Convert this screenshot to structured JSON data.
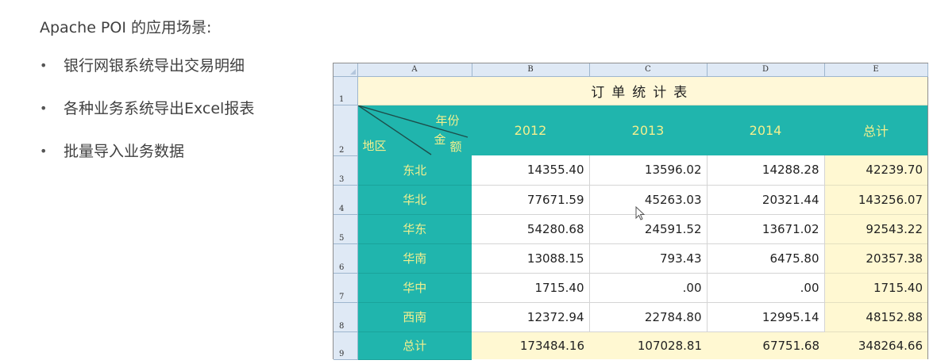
{
  "slide": {
    "title": "Apache POI 的应用场景:",
    "bullet_symbol": "•",
    "bullets": [
      "银行网银系统导出交易明细",
      "各种业务系统导出Excel报表",
      "批量导入业务数据"
    ]
  },
  "sheet": {
    "columns": [
      "A",
      "B",
      "C",
      "D",
      "E"
    ],
    "row_numbers": [
      "1",
      "2",
      "3",
      "4",
      "5",
      "6",
      "7",
      "8",
      "9"
    ],
    "title": "订单统计表",
    "header": {
      "corner_top": "年份",
      "corner_mid": "金",
      "corner_right": "额",
      "corner_left": "地区",
      "years": [
        "2012",
        "2013",
        "2014"
      ],
      "total": "总计"
    },
    "rows": [
      {
        "region": "东北",
        "v2012": "14355.40",
        "v2013": "13596.02",
        "v2014": "14288.28",
        "total": "42239.70"
      },
      {
        "region": "华北",
        "v2012": "77671.59",
        "v2013": "45263.03",
        "v2014": "20321.44",
        "total": "143256.07"
      },
      {
        "region": "华东",
        "v2012": "54280.68",
        "v2013": "24591.52",
        "v2014": "13671.02",
        "total": "92543.22"
      },
      {
        "region": "华南",
        "v2012": "13088.15",
        "v2013": "793.43",
        "v2014": "6475.80",
        "total": "20357.38"
      },
      {
        "region": "华中",
        "v2012": "1715.40",
        "v2013": ".00",
        "v2014": ".00",
        "total": "1715.40"
      },
      {
        "region": "西南",
        "v2012": "12372.94",
        "v2013": "22784.80",
        "v2014": "12995.14",
        "total": "48152.88"
      }
    ],
    "total_row": {
      "region": "总计",
      "v2012": "173484.16",
      "v2013": "107028.81",
      "v2014": "67751.68",
      "total": "348264.66"
    }
  },
  "colors": {
    "teal": "#20b5ad",
    "header_text": "#f2ef8e",
    "title_bg": "#fff8d8",
    "total_bg": "#fff8d2",
    "grid_header_bg": "#dfe9f5"
  }
}
